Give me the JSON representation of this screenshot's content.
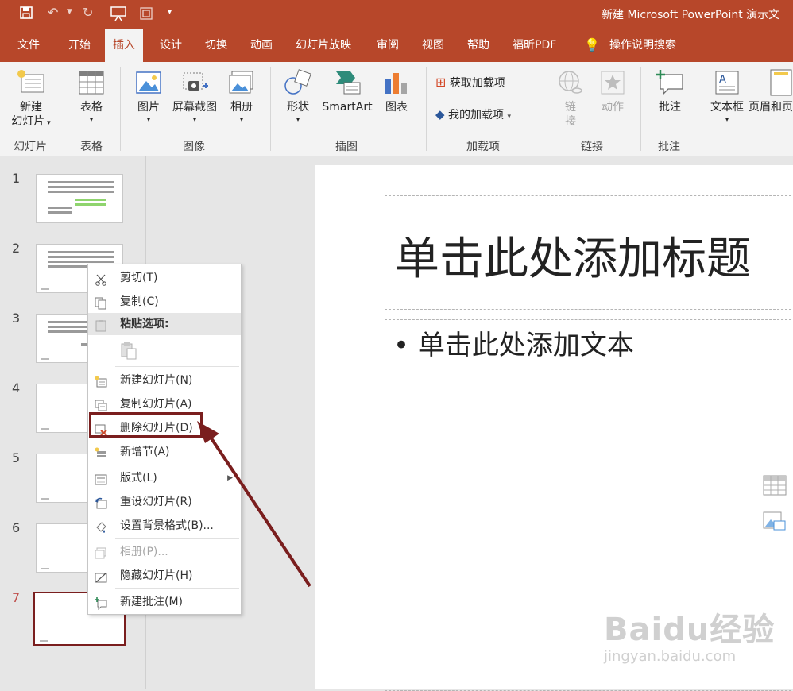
{
  "app": {
    "title": "新建 Microsoft PowerPoint 演示文"
  },
  "tabs": [
    "文件",
    "开始",
    "插入",
    "设计",
    "切换",
    "动画",
    "幻灯片放映",
    "审阅",
    "视图",
    "帮助",
    "福昕PDF",
    "操作说明搜索"
  ],
  "active_tab": "插入",
  "ribbon": {
    "new_slide": "新建\n幻灯片",
    "new_slide_l1": "新建",
    "new_slide_l2": "幻灯片",
    "table": "表格",
    "picture": "图片",
    "screenshot": "屏幕截图",
    "album": "相册",
    "shapes": "形状",
    "smartart": "SmartArt",
    "chart": "图表",
    "get_addins": "获取加载项",
    "my_addins": "我的加载项",
    "link_l1": "链",
    "link_l2": "接",
    "action": "动作",
    "comment": "批注",
    "textbox": "文本框",
    "header_footer": "页眉和页",
    "groups": {
      "slides": "幻灯片",
      "tables": "表格",
      "images": "图像",
      "illustrations": "插图",
      "addins": "加载项",
      "links": "链接",
      "comments": "批注"
    }
  },
  "slides": {
    "numbers": [
      "1",
      "2",
      "3",
      "4",
      "5",
      "6",
      "7"
    ],
    "selected": "7"
  },
  "slide": {
    "title_placeholder": "单击此处添加标题",
    "body_placeholder": "• 单击此处添加文本"
  },
  "context_menu": {
    "cut": "剪切(T)",
    "copy": "复制(C)",
    "paste_options": "粘贴选项:",
    "new_slide": "新建幻灯片(N)",
    "duplicate_slide": "复制幻灯片(A)",
    "delete_slide": "删除幻灯片(D)",
    "add_section": "新增节(A)",
    "layout": "版式(L)",
    "reset_slide": "重设幻灯片(R)",
    "format_background": "设置背景格式(B)...",
    "photo_album": "相册(P)...",
    "hide_slide": "隐藏幻灯片(H)",
    "new_comment": "新建批注(M)"
  },
  "watermark": {
    "brand": "Baidu经验",
    "url": "jingyan.baidu.com"
  },
  "colors": {
    "accent": "#b7472a",
    "highlight": "#7a1e1e"
  }
}
